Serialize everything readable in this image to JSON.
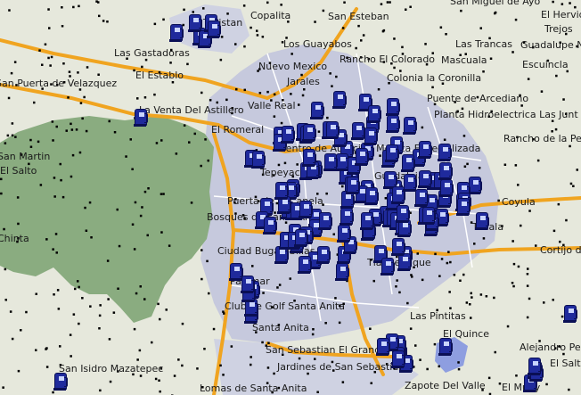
{
  "map": {
    "colors": {
      "background": "#e6e8dc",
      "urban": "#c6c9dd",
      "forest": "#8aac80",
      "highway": "#f0a420",
      "road": "#ffffff",
      "lake": "#8e9ee0",
      "poi": "#000000",
      "gas_station": "#1f2a9c"
    },
    "icons": {
      "gas_station": "gas-station-icon",
      "point_of_interest": "poi-dot"
    },
    "labels": [
      "Copalita",
      "San Esteban",
      "San Miguel de Ayo",
      "El Hervid",
      "Tesistan",
      "Trejos",
      "Los Guayabos",
      "Las Trancas",
      "Guadalupe Ne",
      "Las Gastadoras",
      "Nuevo Mexico",
      "Rancho El Colorado",
      "Mascuala",
      "Escuincla",
      "El Establo",
      "Jarales",
      "Colonia la Coronilla",
      "San Puerta de Velazquez",
      "Puente de Arcediano",
      "La Venta Del Astillero",
      "Valle Real",
      "Planta Hidroelectrica Las Junt",
      "El Romeral",
      "Rancho de la Pe",
      "San Martin",
      "Centro de Atencion Medica Especializada",
      "El Salto",
      "Tepeyac",
      "Guadalajara",
      "Puerta de la Canela",
      "Coyula",
      "Bosques de Santa Ana",
      "Tonala",
      "Chinta",
      "Cortijo d",
      "Ciudad Bugambilias",
      "Tlaquepaque",
      "Palomar",
      "Club de Golf Santa Anita",
      "Las Pintitas",
      "Santa Anita",
      "El Quince",
      "Alejandro Pe",
      "San Sebastian El Grande",
      "El Salto",
      "Jardines de San Sebastian",
      "San Isidro Mazatepec",
      "Lomas de Santa Anita",
      "Zapote Del Valle",
      "El Muey"
    ]
  }
}
